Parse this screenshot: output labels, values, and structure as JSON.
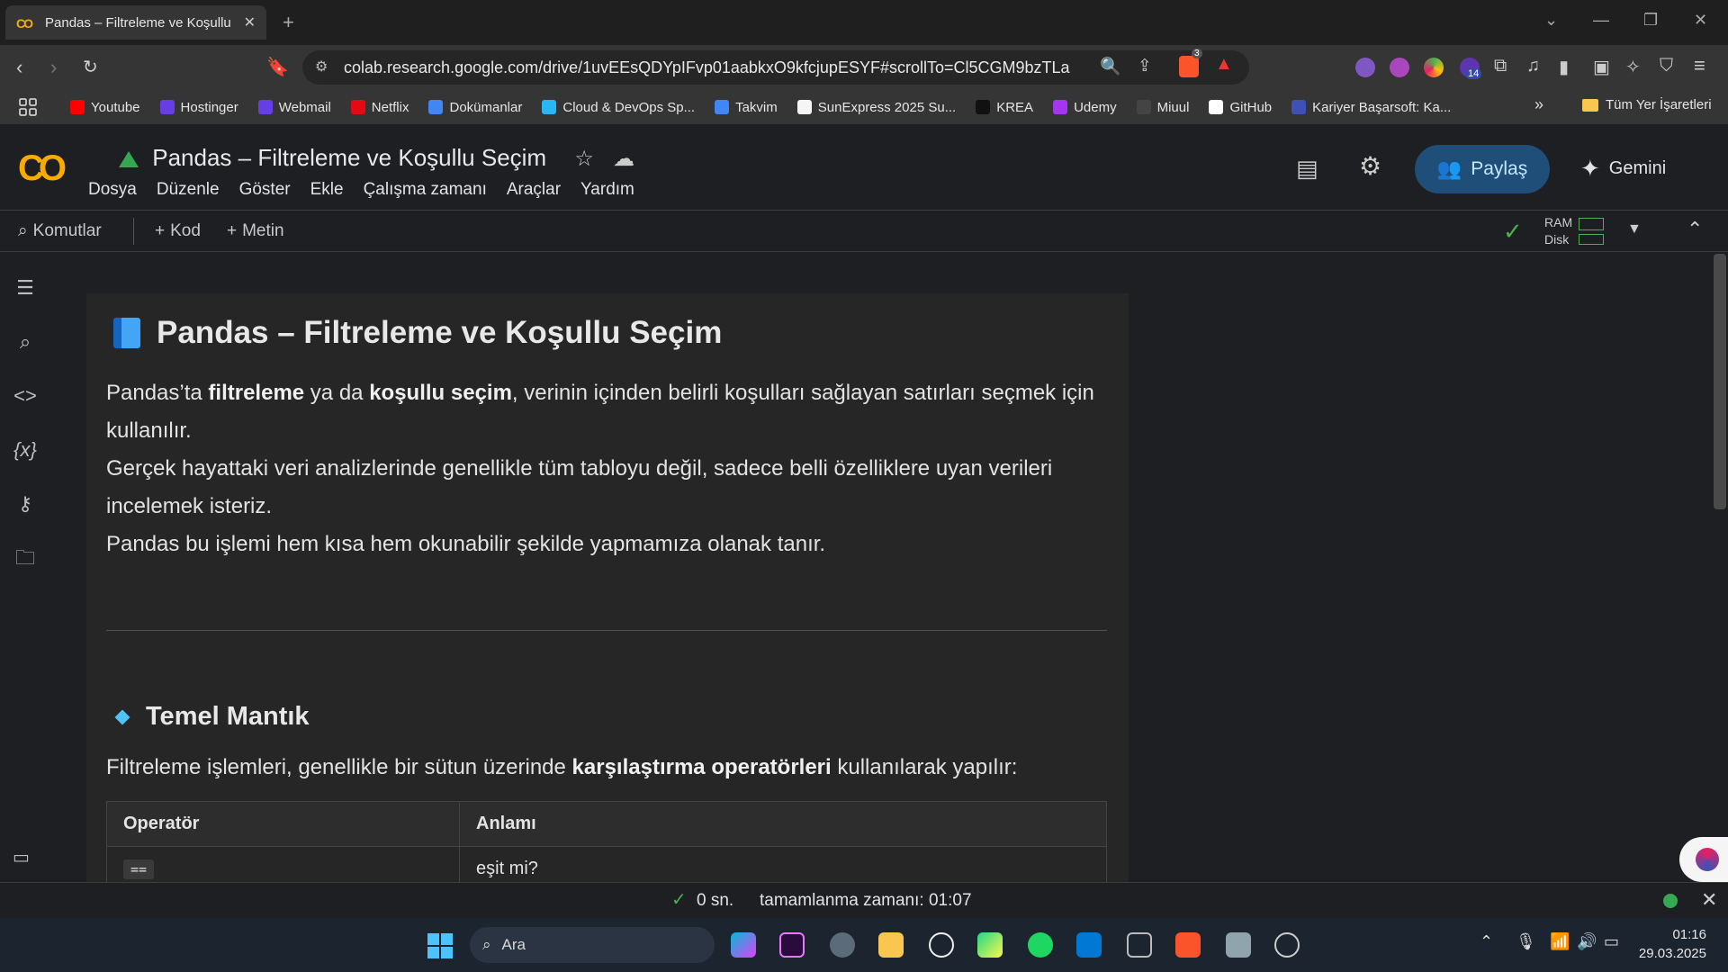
{
  "browser": {
    "tab_title": "Pandas – Filtreleme ve Koşullu",
    "url": "colab.research.google.com/drive/1uvEEsQDYpIFvp01aabkxO9kfcjupESYF#scrollTo=Cl5CGM9bzTLa",
    "ext_badge": "14",
    "brave_badge": "3"
  },
  "bookmarks": [
    {
      "label": "Youtube",
      "color": "#ff0000"
    },
    {
      "label": "Hostinger",
      "color": "#673de6"
    },
    {
      "label": "Webmail",
      "color": "#673de6"
    },
    {
      "label": "Netflix",
      "color": "#e50914"
    },
    {
      "label": "Dokümanlar",
      "color": "#4285f4"
    },
    {
      "label": "Cloud & DevOps Sp...",
      "color": "#29b6f6"
    },
    {
      "label": "Takvim",
      "color": "#4285f4"
    },
    {
      "label": "SunExpress 2025 Su...",
      "color": "#f5f5f5"
    },
    {
      "label": "KREA",
      "color": "#111111"
    },
    {
      "label": "Udemy",
      "color": "#a435f0"
    },
    {
      "label": "Miuul",
      "color": "#444444"
    },
    {
      "label": "GitHub",
      "color": "#ffffff"
    },
    {
      "label": "Kariyer Başarsoft: Ka...",
      "color": "#3f51b5"
    }
  ],
  "bookmarks_folder": "Tüm Yer İşaretleri",
  "colab": {
    "title": "Pandas – Filtreleme ve Koşullu Seçim",
    "menu": [
      "Dosya",
      "Düzenle",
      "Göster",
      "Ekle",
      "Çalışma zamanı",
      "Araçlar",
      "Yardım"
    ],
    "share_label": "Paylaş",
    "gemini_label": "Gemini",
    "toolbar": {
      "commands": "Komutlar",
      "code": "Kod",
      "text": "Metin",
      "ram": "RAM",
      "disk": "Disk"
    }
  },
  "cell": {
    "heading": "Pandas – Filtreleme ve Koşullu Seçim",
    "p1_a": "Pandas’ta ",
    "p1_b": "filtreleme",
    "p1_c": " ya da ",
    "p1_d": "koşullu seçim",
    "p1_e": ", verinin içinden belirli koşulları sağlayan satırları seçmek için kullanılır.",
    "p2": "Gerçek hayattaki veri analizlerinde genellikle tüm tabloyu değil, sadece belli özelliklere uyan verileri incelemek isteriz.",
    "p3": "Pandas bu işlemi hem kısa hem okunabilir şekilde yapmamıza olanak tanır.",
    "h2": "Temel Mantık",
    "p4_a": "Filtreleme işlemleri, genellikle bir sütun üzerinde ",
    "p4_b": "karşılaştırma operatörleri",
    "p4_c": " kullanılarak yapılır:",
    "table": {
      "headers": [
        "Operatör",
        "Anlamı"
      ],
      "rows": [
        [
          "==",
          "eşit mi?"
        ]
      ]
    }
  },
  "status": {
    "time": "0 sn.",
    "completed": "tamamlanma zamanı: 01:07"
  },
  "taskbar": {
    "search": "Ara",
    "time": "01:16",
    "date": "29.03.2025"
  }
}
